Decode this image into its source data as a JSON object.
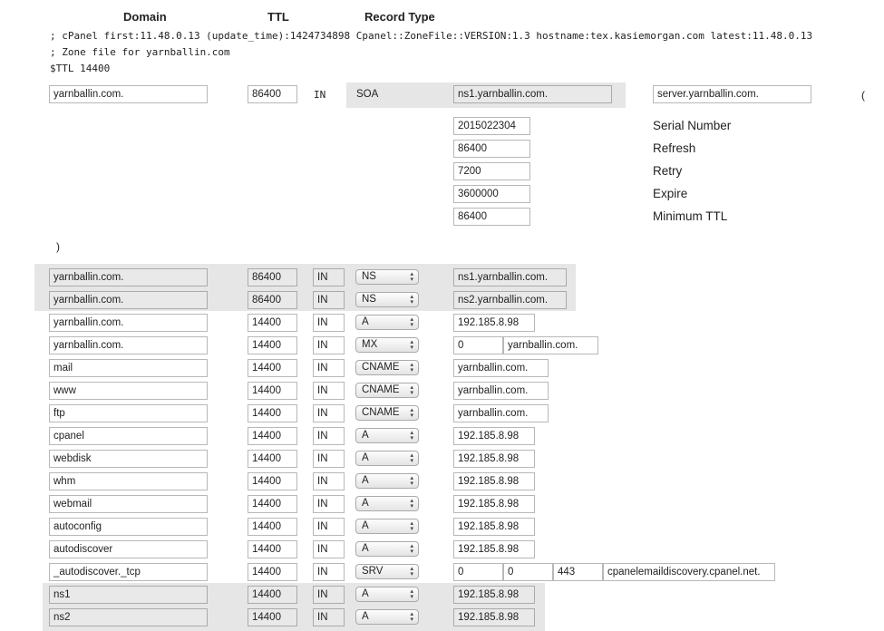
{
  "headers": {
    "domain": "Domain",
    "ttl": "TTL",
    "record_type": "Record Type"
  },
  "zone_lines": [
    "; cPanel first:11.48.0.13 (update_time):1424734898 Cpanel::ZoneFile::VERSION:1.3 hostname:tex.kasiemorgan.com latest:11.48.0.13",
    "; Zone file for yarnballin.com",
    "$TTL 14400"
  ],
  "soa": {
    "domain": "yarnballin.com.",
    "ttl": "86400",
    "class": "IN",
    "type": "SOA",
    "primary_ns": "ns1.yarnballin.com.",
    "admin": "server.yarnballin.com.",
    "open_paren": "(",
    "close_paren": ")",
    "fields": [
      {
        "value": "2015022304",
        "label": "Serial Number"
      },
      {
        "value": "86400",
        "label": "Refresh"
      },
      {
        "value": "7200",
        "label": "Retry"
      },
      {
        "value": "3600000",
        "label": "Expire"
      },
      {
        "value": "86400",
        "label": "Minimum TTL"
      }
    ]
  },
  "records": [
    {
      "name": "yarnballin.com.",
      "ttl": "86400",
      "class": "IN",
      "type": "NS",
      "data": [
        "ns1.yarnballin.com."
      ]
    },
    {
      "name": "yarnballin.com.",
      "ttl": "86400",
      "class": "IN",
      "type": "NS",
      "data": [
        "ns2.yarnballin.com."
      ]
    },
    {
      "name": "yarnballin.com.",
      "ttl": "14400",
      "class": "IN",
      "type": "A",
      "data": [
        "192.185.8.98"
      ]
    },
    {
      "name": "yarnballin.com.",
      "ttl": "14400",
      "class": "IN",
      "type": "MX",
      "data": [
        "0",
        "yarnballin.com."
      ]
    },
    {
      "name": "mail",
      "ttl": "14400",
      "class": "IN",
      "type": "CNAME",
      "data": [
        "yarnballin.com."
      ]
    },
    {
      "name": "www",
      "ttl": "14400",
      "class": "IN",
      "type": "CNAME",
      "data": [
        "yarnballin.com."
      ]
    },
    {
      "name": "ftp",
      "ttl": "14400",
      "class": "IN",
      "type": "CNAME",
      "data": [
        "yarnballin.com."
      ]
    },
    {
      "name": "cpanel",
      "ttl": "14400",
      "class": "IN",
      "type": "A",
      "data": [
        "192.185.8.98"
      ]
    },
    {
      "name": "webdisk",
      "ttl": "14400",
      "class": "IN",
      "type": "A",
      "data": [
        "192.185.8.98"
      ]
    },
    {
      "name": "whm",
      "ttl": "14400",
      "class": "IN",
      "type": "A",
      "data": [
        "192.185.8.98"
      ]
    },
    {
      "name": "webmail",
      "ttl": "14400",
      "class": "IN",
      "type": "A",
      "data": [
        "192.185.8.98"
      ]
    },
    {
      "name": "autoconfig",
      "ttl": "14400",
      "class": "IN",
      "type": "A",
      "data": [
        "192.185.8.98"
      ]
    },
    {
      "name": "autodiscover",
      "ttl": "14400",
      "class": "IN",
      "type": "A",
      "data": [
        "192.185.8.98"
      ]
    },
    {
      "name": "_autodiscover._tcp",
      "ttl": "14400",
      "class": "IN",
      "type": "SRV",
      "data": [
        "0",
        "0",
        "443",
        "cpanelemaildiscovery.cpanel.net."
      ]
    },
    {
      "name": "ns1",
      "ttl": "14400",
      "class": "IN",
      "type": "A",
      "data": [
        "192.185.8.98"
      ]
    },
    {
      "name": "ns2",
      "ttl": "14400",
      "class": "IN",
      "type": "A",
      "data": [
        "192.185.8.98"
      ]
    }
  ],
  "colors": {
    "shade": "#e6e6e6",
    "readonly": "#e9e9e9",
    "border": "#b8b8b8"
  }
}
